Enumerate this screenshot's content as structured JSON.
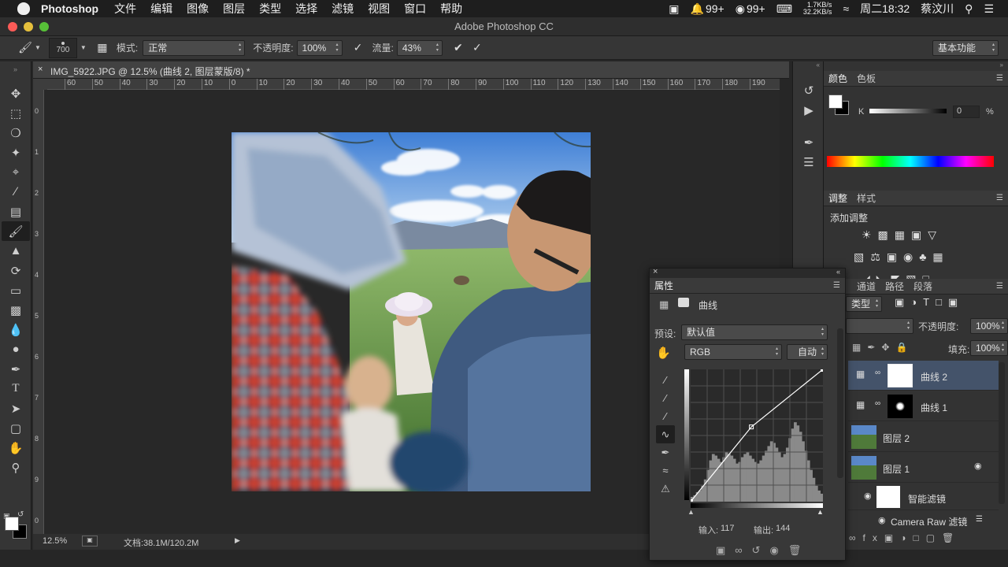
{
  "menubar": {
    "app": "Photoshop",
    "items": [
      "文件",
      "编辑",
      "图像",
      "图层",
      "类型",
      "选择",
      "滤镜",
      "视图",
      "窗口",
      "帮助"
    ],
    "badge1": "99+",
    "badge2": "99+",
    "net_up": "1.7KB/s",
    "net_down": "32.2KB/s",
    "clock": "周二18:32",
    "user": "蔡汶川"
  },
  "window": {
    "title": "Adobe Photoshop CC"
  },
  "options": {
    "brush_size": "700",
    "mode_label": "模式:",
    "mode_value": "正常",
    "opacity_label": "不透明度:",
    "opacity_value": "100%",
    "flow_label": "流量:",
    "flow_value": "43%",
    "workspace": "基本功能"
  },
  "document": {
    "tab_title": "IMG_5922.JPG @ 12.5% (曲线 2, 图层蒙版/8) *",
    "zoom": "12.5%",
    "doc_size": "文档:38.1M/120.2M"
  },
  "rulers": {
    "h_ticks": [
      "60",
      "50",
      "40",
      "30",
      "20",
      "10",
      "0",
      "10",
      "20",
      "30",
      "40",
      "50",
      "60",
      "70",
      "80",
      "90",
      "100",
      "110",
      "120",
      "130",
      "140",
      "150",
      "160",
      "170",
      "180",
      "190"
    ],
    "v_ticks": [
      "0",
      "1",
      "2",
      "3",
      "4",
      "5",
      "6",
      "7",
      "8",
      "9",
      "0"
    ]
  },
  "color_panel": {
    "tabs": [
      "颜色",
      "色板"
    ],
    "channel": "K",
    "value": "0",
    "unit": "%"
  },
  "adjust_panel": {
    "tabs": [
      "调整",
      "样式"
    ],
    "title": "添加调整"
  },
  "properties": {
    "tab": "属性",
    "title": "曲线",
    "preset_label": "预设:",
    "preset_value": "默认值",
    "channel": "RGB",
    "auto": "自动",
    "input_label": "输入:",
    "input_value": "117",
    "output_label": "输出:",
    "output_value": "144"
  },
  "curve_data": {
    "control_points": [
      [
        0,
        0
      ],
      [
        117,
        144
      ],
      [
        255,
        255
      ]
    ],
    "histogram": [
      6,
      8,
      12,
      14,
      20,
      28,
      40,
      52,
      60,
      58,
      54,
      50,
      56,
      62,
      60,
      58,
      54,
      48,
      50,
      56,
      60,
      62,
      58,
      54,
      50,
      48,
      52,
      58,
      64,
      70,
      76,
      74,
      68,
      62,
      56,
      60,
      68,
      80,
      92,
      100,
      96,
      88,
      76,
      64,
      52,
      40,
      30,
      20,
      14,
      10
    ]
  },
  "layers_panel": {
    "tabs": [
      "通道",
      "路径",
      "段落"
    ],
    "kind_label": "类型",
    "opacity_label": "不透明度:",
    "opacity_value": "100%",
    "fill_label": "填充:",
    "fill_value": "100%",
    "layers": [
      "曲线 2",
      "曲线 1",
      "图层 2",
      "图层 1",
      "智能滤镜",
      "Camera Raw 滤镜"
    ]
  }
}
